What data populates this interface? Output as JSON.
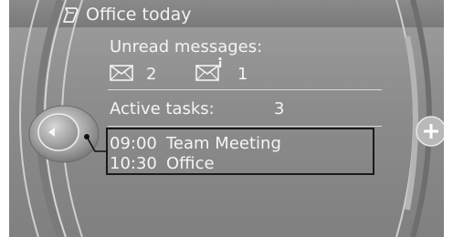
{
  "header": {
    "title": "Office today",
    "title_icon": "notebook-icon"
  },
  "unread": {
    "label": "Unread messages:",
    "email_icon": "envelope-icon",
    "email_count": "2",
    "sms_icon": "envelope-info-icon",
    "sms_count": "1"
  },
  "tasks": {
    "label": "Active tasks:",
    "count": "3"
  },
  "appointments": [
    {
      "time": "09:00",
      "title": "Team Meeting"
    },
    {
      "time": "10:30",
      "title": "Office"
    }
  ],
  "controls": {
    "left_knob_icon": "left-arrow-icon",
    "right_icon": "plus-icon"
  },
  "colors": {
    "screen_bg": "#8c8c8c",
    "text": "#f4f4f4",
    "callout_border": "#1a1a1a"
  }
}
